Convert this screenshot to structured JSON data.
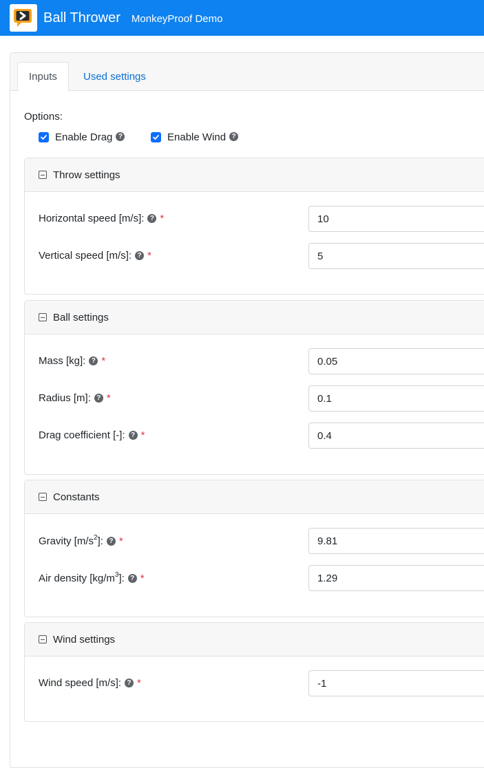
{
  "header": {
    "brand": "Ball Thrower",
    "subtitle": "MonkeyProof Demo",
    "accent_color": "#0d82f0",
    "logo_icon": "chevron-right-speech-bubble-icon"
  },
  "tabs": [
    {
      "label": "Inputs",
      "active": true
    },
    {
      "label": "Used settings",
      "active": false
    }
  ],
  "options": {
    "label": "Options:",
    "enable_drag": {
      "label": "Enable Drag",
      "checked": true
    },
    "enable_wind": {
      "label": "Enable Wind",
      "checked": true
    }
  },
  "sections": {
    "throw": {
      "title": "Throw settings",
      "horizontal_speed": {
        "label": "Horizontal speed [m/s]:",
        "value": "10"
      },
      "vertical_speed": {
        "label": "Vertical speed [m/s]:",
        "value": "5"
      }
    },
    "ball": {
      "title": "Ball settings",
      "mass": {
        "label": "Mass [kg]:",
        "value": "0.05"
      },
      "radius": {
        "label": "Radius [m]:",
        "value": "0.1"
      },
      "drag_coefficient": {
        "label": "Drag coefficient [-]:",
        "value": "0.4"
      }
    },
    "constants": {
      "title": "Constants",
      "gravity": {
        "label_pre": "Gravity [m/s",
        "label_sup": "2",
        "label_post": "]:",
        "value": "9.81"
      },
      "air_density": {
        "label_pre": "Air density [kg/m",
        "label_sup": "3",
        "label_post": "]:",
        "value": "1.29"
      }
    },
    "wind": {
      "title": "Wind settings",
      "wind_speed": {
        "label": "Wind speed [m/s]:",
        "value": "-1"
      }
    }
  },
  "common": {
    "help_glyph": "?",
    "required_mark": "*"
  }
}
